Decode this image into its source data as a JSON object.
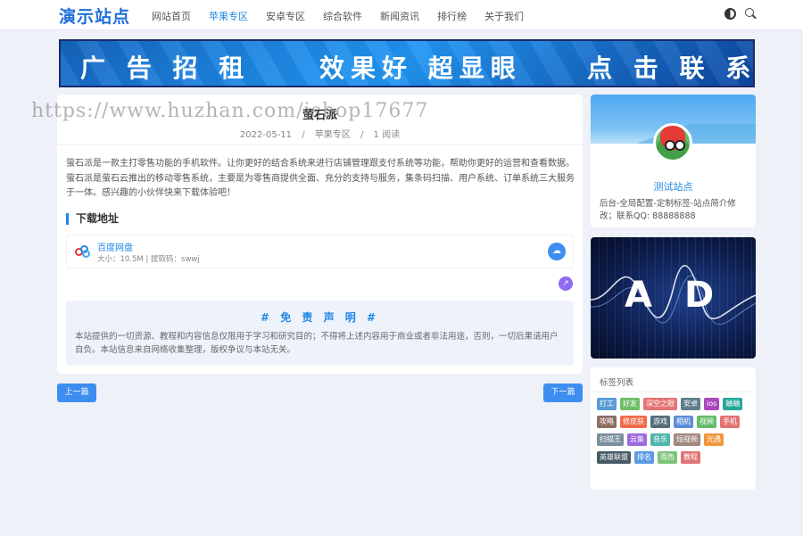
{
  "header": {
    "logo": "演示站点",
    "nav": [
      "网站首页",
      "苹果专区",
      "安卓专区",
      "综合软件",
      "新闻资讯",
      "排行榜",
      "关于我们"
    ],
    "active_index": 1
  },
  "banner": {
    "part1": "广 告 招 租",
    "part2": "效果好 超显眼",
    "part3": "点 击 联 系"
  },
  "article": {
    "title": "萤石派",
    "date": "2022-05-11",
    "sep": "/",
    "category": "苹果专区",
    "reads": "1 阅读",
    "body": "萤石派是一款主打零售功能的手机软件。让你更好的结合系统来进行店铺管理跟支付系统等功能，帮助你更好的运营和查看数据。萤石派是萤石云推出的移动零售系统，主要是为零售商提供全面、充分的支持与服务，集条码扫描、用户系统、订单系统三大服务于一体。感兴趣的小伙伴快来下载体验吧！",
    "download_heading": "下载地址",
    "download": {
      "name": "百度网盘",
      "info": "大小：10.5M | 提取码：swwj"
    },
    "disclaimer_title": "# 免 责 声 明 #",
    "disclaimer_text": "本站提供的一切资源、教程和内容信息仅限用于学习和研究目的；不得将上述内容用于商业或者非法用途，否则，一切后果请用户自负。本站信息来自网络收集整理，版权争议与本站无关。"
  },
  "pager": {
    "prev": "上一篇",
    "next": "下一篇"
  },
  "sidebar": {
    "site_name": "测试站点",
    "site_desc": "后台-全局配置-定制标签-站点简介修改；联系QQ: 88888888",
    "ad": {
      "letter1": "A",
      "letter2": "D"
    },
    "tags_title": "标签列表",
    "tags": [
      {
        "label": "打工",
        "color": "#5b9bd5"
      },
      {
        "label": "好友",
        "color": "#6dbf67"
      },
      {
        "label": "深空之眼",
        "color": "#e57373"
      },
      {
        "label": "安卓",
        "color": "#607d8b"
      },
      {
        "label": "ios",
        "color": "#ab47bc"
      },
      {
        "label": "蛐蛐",
        "color": "#26a69a"
      },
      {
        "label": "攻略",
        "color": "#8d6e63"
      },
      {
        "label": "修皮肤",
        "color": "#ef6c4a"
      },
      {
        "label": "游戏",
        "color": "#546e7a"
      },
      {
        "label": "相机",
        "color": "#5c8fd6"
      },
      {
        "label": "视频",
        "color": "#66bb6a"
      },
      {
        "label": "手机",
        "color": "#e57373"
      },
      {
        "label": "扫描王",
        "color": "#78909c"
      },
      {
        "label": "云集",
        "color": "#9c6ade"
      },
      {
        "label": "音乐",
        "color": "#4db6ac"
      },
      {
        "label": "短视频",
        "color": "#a1887f"
      },
      {
        "label": "光遇",
        "color": "#f0953a"
      },
      {
        "label": "英雄联盟",
        "color": "#455a64"
      },
      {
        "label": "排名",
        "color": "#5c9ae6"
      },
      {
        "label": "雨色",
        "color": "#7cc47a"
      },
      {
        "label": "教程",
        "color": "#e07474"
      }
    ]
  },
  "watermark": "https://www.huzhan.com/ishop17677"
}
